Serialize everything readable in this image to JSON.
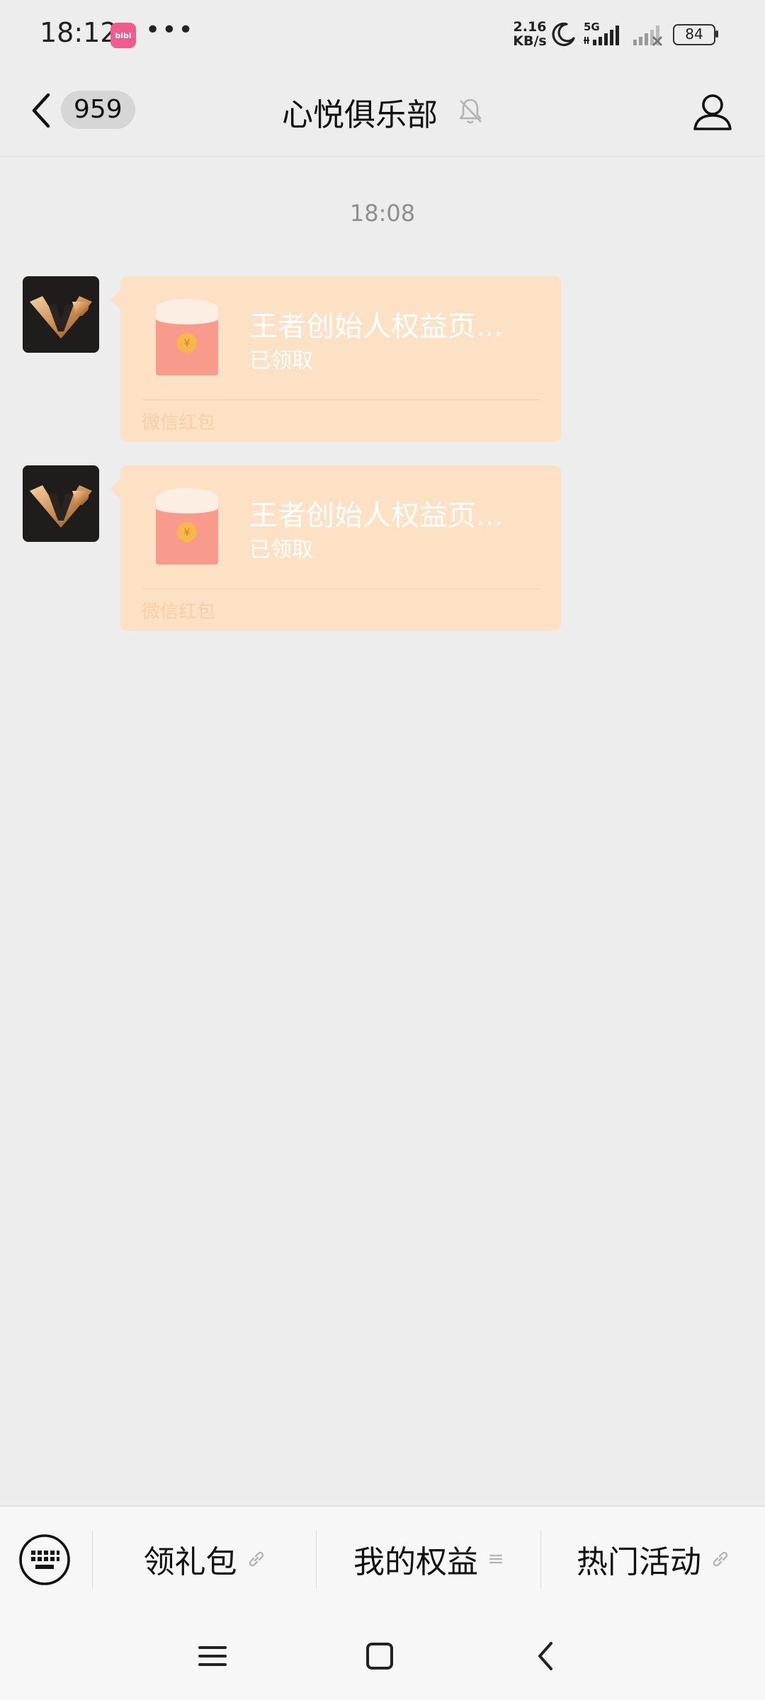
{
  "status_bar": {
    "time": "18:12",
    "app_icon_text": "bibi",
    "more_dots": "•••",
    "net_speed_value": "2.16",
    "net_speed_unit": "KB/s",
    "network_type": "5G",
    "battery_level": "84"
  },
  "header": {
    "unread_count": "959",
    "title": "心悦俱乐部"
  },
  "messages": {
    "timestamp": "18:08",
    "items": [
      {
        "title": "王者创始人权益页...",
        "status": "已领取",
        "footer": "微信红包"
      },
      {
        "title": "王者创始人权益页...",
        "status": "已领取",
        "footer": "微信红包"
      }
    ]
  },
  "bottom_menu": {
    "items": [
      {
        "label": "领礼包",
        "icon": "link-icon"
      },
      {
        "label": "我的权益",
        "icon": "list-icon"
      },
      {
        "label": "热门活动",
        "icon": "link-icon"
      }
    ]
  },
  "colors": {
    "background": "#ededed",
    "red_packet_bubble": "#fde1c4",
    "envelope_red": "#f89a8c",
    "coin_gold": "#f5b84a",
    "badge_gray": "#d6d6d6"
  }
}
